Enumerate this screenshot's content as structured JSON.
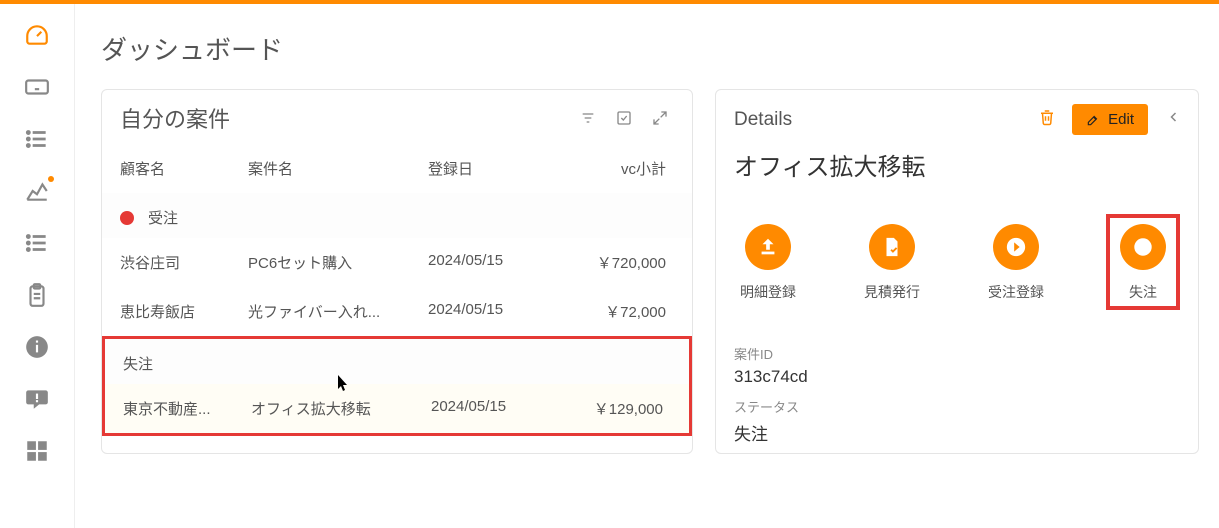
{
  "page": {
    "title": "ダッシュボード"
  },
  "sidebar_icons": [
    "dashboard",
    "keyboard",
    "list",
    "chart",
    "list2",
    "clipboard",
    "info",
    "comment",
    "apps"
  ],
  "cases": {
    "title": "自分の案件",
    "columns": {
      "cust": "顧客名",
      "name": "案件名",
      "date": "登録日",
      "amt": "vc小計"
    },
    "groups": [
      {
        "label": "受注",
        "has_dot": true,
        "rows": [
          {
            "cust": "渋谷庄司",
            "name": "PC6セット購入",
            "date": "2024/05/15",
            "amt": "￥720,000"
          },
          {
            "cust": "恵比寿飯店",
            "name": "光ファイバー入れ...",
            "date": "2024/05/15",
            "amt": "￥72,000"
          }
        ]
      },
      {
        "label": "失注",
        "has_dot": false,
        "rows": [
          {
            "cust": "東京不動産...",
            "name": "オフィス拡大移転",
            "date": "2024/05/15",
            "amt": "￥129,000"
          }
        ]
      }
    ]
  },
  "details": {
    "title": "Details",
    "edit_label": "Edit",
    "name": "オフィス拡大移転",
    "actions": [
      {
        "key": "detail_reg",
        "label": "明細登録",
        "icon": "upload"
      },
      {
        "key": "quote",
        "label": "見積発行",
        "icon": "file"
      },
      {
        "key": "order_reg",
        "label": "受注登録",
        "icon": "arrow"
      },
      {
        "key": "lost",
        "label": "失注",
        "icon": "forbid"
      }
    ],
    "fields": {
      "id_label": "案件ID",
      "id_value": "313c74cd",
      "status_label": "ステータス",
      "status_value": "失注"
    }
  }
}
